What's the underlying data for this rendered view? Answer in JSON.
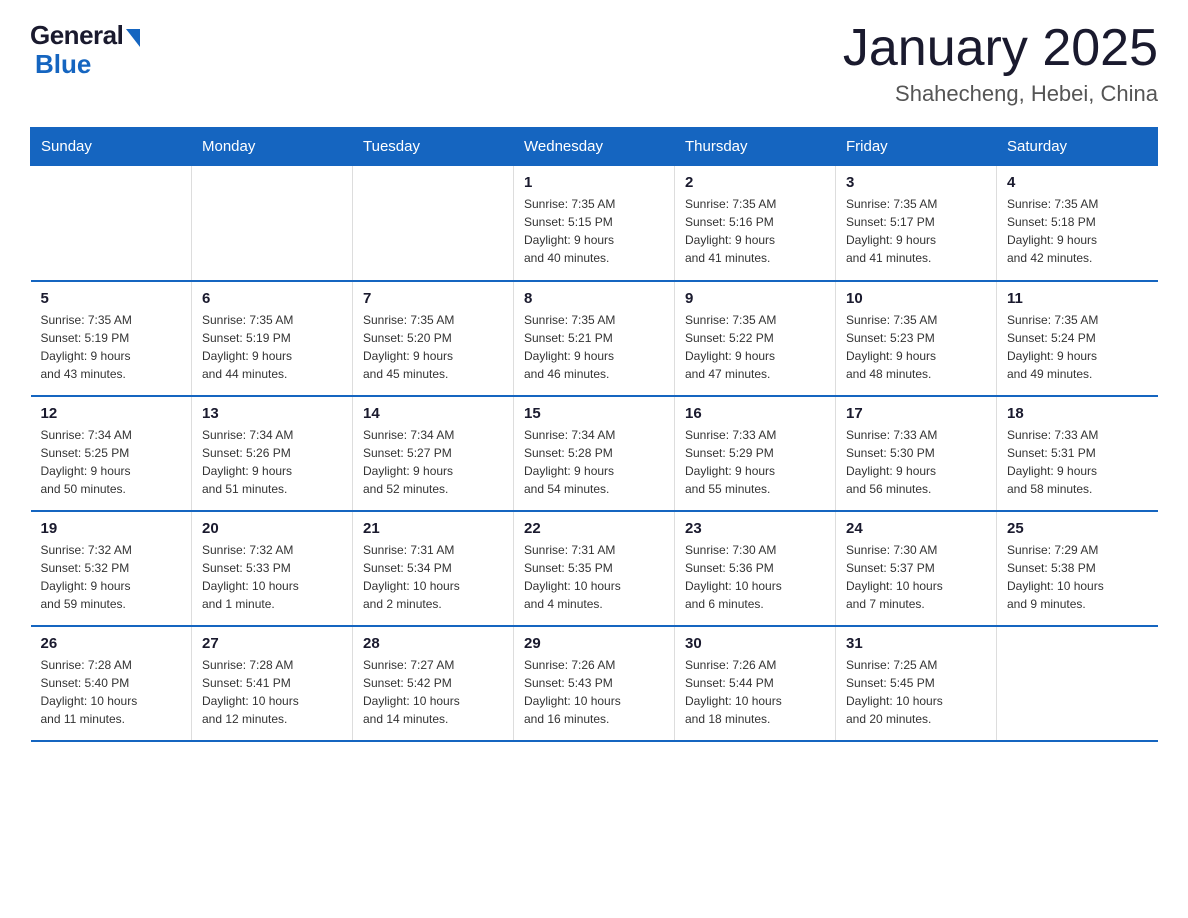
{
  "logo": {
    "general": "General",
    "blue": "Blue",
    "tagline": "Blue"
  },
  "header": {
    "month": "January 2025",
    "location": "Shahecheng, Hebei, China"
  },
  "weekdays": [
    "Sunday",
    "Monday",
    "Tuesday",
    "Wednesday",
    "Thursday",
    "Friday",
    "Saturday"
  ],
  "weeks": [
    [
      {
        "day": "",
        "info": ""
      },
      {
        "day": "",
        "info": ""
      },
      {
        "day": "",
        "info": ""
      },
      {
        "day": "1",
        "info": "Sunrise: 7:35 AM\nSunset: 5:15 PM\nDaylight: 9 hours\nand 40 minutes."
      },
      {
        "day": "2",
        "info": "Sunrise: 7:35 AM\nSunset: 5:16 PM\nDaylight: 9 hours\nand 41 minutes."
      },
      {
        "day": "3",
        "info": "Sunrise: 7:35 AM\nSunset: 5:17 PM\nDaylight: 9 hours\nand 41 minutes."
      },
      {
        "day": "4",
        "info": "Sunrise: 7:35 AM\nSunset: 5:18 PM\nDaylight: 9 hours\nand 42 minutes."
      }
    ],
    [
      {
        "day": "5",
        "info": "Sunrise: 7:35 AM\nSunset: 5:19 PM\nDaylight: 9 hours\nand 43 minutes."
      },
      {
        "day": "6",
        "info": "Sunrise: 7:35 AM\nSunset: 5:19 PM\nDaylight: 9 hours\nand 44 minutes."
      },
      {
        "day": "7",
        "info": "Sunrise: 7:35 AM\nSunset: 5:20 PM\nDaylight: 9 hours\nand 45 minutes."
      },
      {
        "day": "8",
        "info": "Sunrise: 7:35 AM\nSunset: 5:21 PM\nDaylight: 9 hours\nand 46 minutes."
      },
      {
        "day": "9",
        "info": "Sunrise: 7:35 AM\nSunset: 5:22 PM\nDaylight: 9 hours\nand 47 minutes."
      },
      {
        "day": "10",
        "info": "Sunrise: 7:35 AM\nSunset: 5:23 PM\nDaylight: 9 hours\nand 48 minutes."
      },
      {
        "day": "11",
        "info": "Sunrise: 7:35 AM\nSunset: 5:24 PM\nDaylight: 9 hours\nand 49 minutes."
      }
    ],
    [
      {
        "day": "12",
        "info": "Sunrise: 7:34 AM\nSunset: 5:25 PM\nDaylight: 9 hours\nand 50 minutes."
      },
      {
        "day": "13",
        "info": "Sunrise: 7:34 AM\nSunset: 5:26 PM\nDaylight: 9 hours\nand 51 minutes."
      },
      {
        "day": "14",
        "info": "Sunrise: 7:34 AM\nSunset: 5:27 PM\nDaylight: 9 hours\nand 52 minutes."
      },
      {
        "day": "15",
        "info": "Sunrise: 7:34 AM\nSunset: 5:28 PM\nDaylight: 9 hours\nand 54 minutes."
      },
      {
        "day": "16",
        "info": "Sunrise: 7:33 AM\nSunset: 5:29 PM\nDaylight: 9 hours\nand 55 minutes."
      },
      {
        "day": "17",
        "info": "Sunrise: 7:33 AM\nSunset: 5:30 PM\nDaylight: 9 hours\nand 56 minutes."
      },
      {
        "day": "18",
        "info": "Sunrise: 7:33 AM\nSunset: 5:31 PM\nDaylight: 9 hours\nand 58 minutes."
      }
    ],
    [
      {
        "day": "19",
        "info": "Sunrise: 7:32 AM\nSunset: 5:32 PM\nDaylight: 9 hours\nand 59 minutes."
      },
      {
        "day": "20",
        "info": "Sunrise: 7:32 AM\nSunset: 5:33 PM\nDaylight: 10 hours\nand 1 minute."
      },
      {
        "day": "21",
        "info": "Sunrise: 7:31 AM\nSunset: 5:34 PM\nDaylight: 10 hours\nand 2 minutes."
      },
      {
        "day": "22",
        "info": "Sunrise: 7:31 AM\nSunset: 5:35 PM\nDaylight: 10 hours\nand 4 minutes."
      },
      {
        "day": "23",
        "info": "Sunrise: 7:30 AM\nSunset: 5:36 PM\nDaylight: 10 hours\nand 6 minutes."
      },
      {
        "day": "24",
        "info": "Sunrise: 7:30 AM\nSunset: 5:37 PM\nDaylight: 10 hours\nand 7 minutes."
      },
      {
        "day": "25",
        "info": "Sunrise: 7:29 AM\nSunset: 5:38 PM\nDaylight: 10 hours\nand 9 minutes."
      }
    ],
    [
      {
        "day": "26",
        "info": "Sunrise: 7:28 AM\nSunset: 5:40 PM\nDaylight: 10 hours\nand 11 minutes."
      },
      {
        "day": "27",
        "info": "Sunrise: 7:28 AM\nSunset: 5:41 PM\nDaylight: 10 hours\nand 12 minutes."
      },
      {
        "day": "28",
        "info": "Sunrise: 7:27 AM\nSunset: 5:42 PM\nDaylight: 10 hours\nand 14 minutes."
      },
      {
        "day": "29",
        "info": "Sunrise: 7:26 AM\nSunset: 5:43 PM\nDaylight: 10 hours\nand 16 minutes."
      },
      {
        "day": "30",
        "info": "Sunrise: 7:26 AM\nSunset: 5:44 PM\nDaylight: 10 hours\nand 18 minutes."
      },
      {
        "day": "31",
        "info": "Sunrise: 7:25 AM\nSunset: 5:45 PM\nDaylight: 10 hours\nand 20 minutes."
      },
      {
        "day": "",
        "info": ""
      }
    ]
  ]
}
